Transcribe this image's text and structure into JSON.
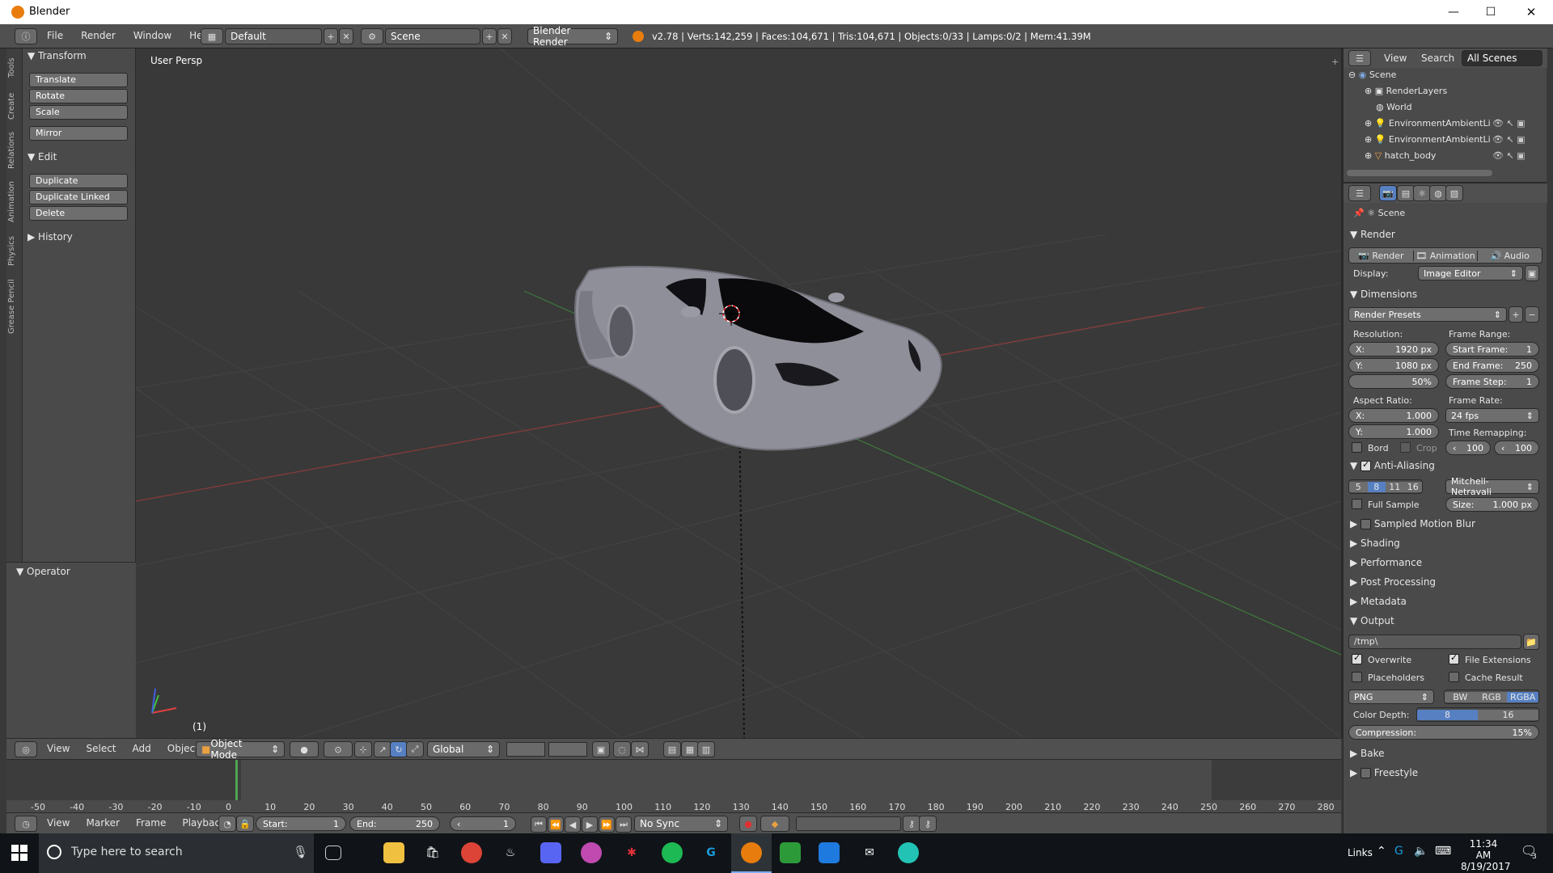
{
  "window": {
    "title": "Blender",
    "minimize": "—",
    "maximize": "☐",
    "close": "✕"
  },
  "infobar": {
    "menus": [
      "File",
      "Render",
      "Window",
      "Help"
    ],
    "layout": "Default",
    "scene": "Scene",
    "engine": "Blender Render",
    "stats": "v2.78 | Verts:142,259 | Faces:104,671 | Tris:104,671 | Objects:0/33 | Lamps:0/2 | Mem:41.39M"
  },
  "tabs": [
    "Tools",
    "Create",
    "Relations",
    "Animation",
    "Physics",
    "Grease Pencil"
  ],
  "toolshelf": {
    "transform_header": "Transform",
    "translate": "Translate",
    "rotate": "Rotate",
    "scale": "Scale",
    "mirror": "Mirror",
    "edit_header": "Edit",
    "duplicate": "Duplicate",
    "duplicate_linked": "Duplicate Linked",
    "delete": "Delete",
    "history_header": "History",
    "operator_header": "Operator"
  },
  "viewport": {
    "label": "User Persp",
    "frame": "(1)"
  },
  "v3dheader": {
    "view": "View",
    "select": "Select",
    "add": "Add",
    "object": "Object",
    "mode": "Object Mode",
    "orientation": "Global"
  },
  "timeline": {
    "ticks": [
      "-50",
      "-40",
      "-30",
      "-20",
      "-10",
      "0",
      "10",
      "20",
      "30",
      "40",
      "50",
      "60",
      "70",
      "80",
      "90",
      "100",
      "110",
      "120",
      "130",
      "140",
      "150",
      "160",
      "170",
      "180",
      "190",
      "200",
      "210",
      "220",
      "230",
      "240",
      "250",
      "260",
      "270",
      "280"
    ],
    "current_frame": 1
  },
  "tlheader": {
    "view": "View",
    "marker": "Marker",
    "frame": "Frame",
    "playback": "Playback",
    "start_label": "Start:",
    "start": "1",
    "end_label": "End:",
    "end": "250",
    "current": "1",
    "sync": "No Sync"
  },
  "outliner": {
    "view": "View",
    "search": "Search",
    "filter": "All Scenes",
    "items": [
      "Scene",
      "RenderLayers",
      "World",
      "EnvironmentAmbientLi",
      "EnvironmentAmbientLi",
      "hatch_body"
    ]
  },
  "props": {
    "context": "Scene",
    "render_header": "Render",
    "render_btn": "Render",
    "animation_btn": "Animation",
    "audio_btn": "Audio",
    "display_label": "Display:",
    "display_value": "Image Editor",
    "dimensions_header": "Dimensions",
    "presets": "Render Presets",
    "resolution_label": "Resolution:",
    "res_x_label": "X:",
    "res_x": "1920 px",
    "res_y_label": "Y:",
    "res_y": "1080 px",
    "res_pct": "50%",
    "frame_range_label": "Frame Range:",
    "start_frame_label": "Start Frame:",
    "start_frame": "1",
    "end_frame_label": "End Frame:",
    "end_frame": "250",
    "frame_step_label": "Frame Step:",
    "frame_step": "1",
    "aspect_label": "Aspect Ratio:",
    "aspect_x_label": "X:",
    "aspect_x": "1.000",
    "aspect_y_label": "Y:",
    "aspect_y": "1.000",
    "frame_rate_label": "Frame Rate:",
    "frame_rate": "24 fps",
    "time_remap_label": "Time Remapping:",
    "remap_old": "100",
    "remap_new": "100",
    "bord": "Bord",
    "crop": "Crop",
    "aa_header": "Anti-Aliasing",
    "aa_samples": [
      "5",
      "8",
      "11",
      "16"
    ],
    "aa_filter": "Mitchell-Netravali",
    "full_sample": "Full Sample",
    "size_label": "Size:",
    "size": "1.000 px",
    "collapsed": [
      "Sampled Motion Blur",
      "Shading",
      "Performance",
      "Post Processing",
      "Metadata"
    ],
    "output_header": "Output",
    "output_path": "/tmp\\",
    "overwrite": "Overwrite",
    "file_ext": "File Extensions",
    "placeholders": "Placeholders",
    "cache_result": "Cache Result",
    "format": "PNG",
    "bw": "BW",
    "rgb": "RGB",
    "rgba": "RGBA",
    "color_depth_label": "Color Depth:",
    "depth_8": "8",
    "depth_16": "16",
    "compression_label": "Compression:",
    "compression": "15%",
    "bake": "Bake",
    "freestyle": "Freestyle"
  },
  "taskbar": {
    "search_placeholder": "Type here to search",
    "links": "Links",
    "time": "11:34 AM",
    "date": "8/19/2017",
    "notif_count": "3"
  },
  "colors": {
    "accent": "#5680c2",
    "bg": "#393939",
    "panel": "#4a4a4a",
    "header": "#505050"
  }
}
